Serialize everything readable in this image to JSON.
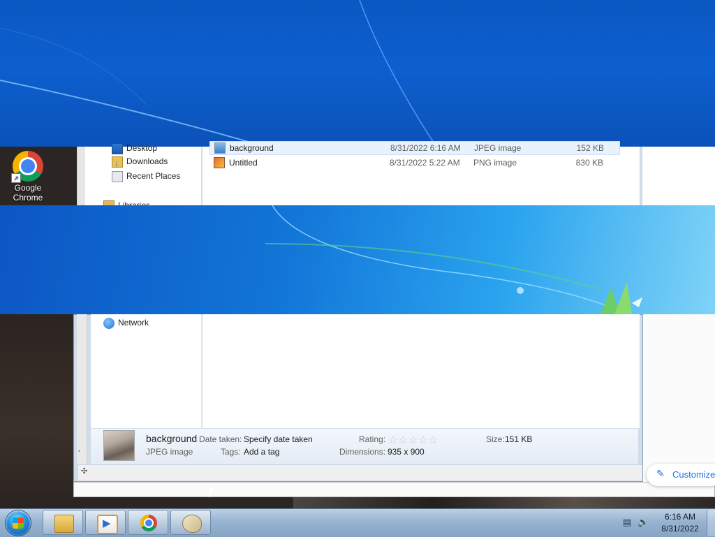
{
  "desktop": {
    "icons": [
      {
        "label": "Google Chrome",
        "icon": "chrome-icon"
      }
    ]
  },
  "explorer": {
    "nav": {
      "items": [
        {
          "label": "Desktop",
          "icon": "desktop-icon"
        },
        {
          "label": "Downloads",
          "icon": "downloads-icon"
        },
        {
          "label": "Recent Places",
          "icon": "recent-places-icon"
        },
        {
          "label": "Libraries",
          "icon": "libraries-icon"
        },
        {
          "label": "Network",
          "icon": "network-icon"
        }
      ]
    },
    "files": [
      {
        "name": "background",
        "date": "8/31/2022 6:16 AM",
        "type": "JPEG image",
        "size": "152 KB",
        "selected": true,
        "icon": "jpeg-file-icon"
      },
      {
        "name": "Untitled",
        "date": "8/31/2022 5:22 AM",
        "type": "PNG image",
        "size": "830 KB",
        "selected": false,
        "icon": "png-file-icon"
      }
    ],
    "details": {
      "name": "background",
      "type": "JPEG image",
      "date_taken_label": "Date taken:",
      "date_taken_value": "Specify date taken",
      "tags_label": "Tags:",
      "tags_value": "Add a tag",
      "rating_label": "Rating:",
      "rating_stars": 0,
      "rating_max": 5,
      "dimensions_label": "Dimensions:",
      "dimensions_value": "935 x 900",
      "size_label": "Size:",
      "size_value": "151 KB"
    }
  },
  "customize": {
    "label": "Customize",
    "icon": "pencil-icon"
  },
  "taskbar": {
    "start": {
      "icon": "windows-start-icon"
    },
    "buttons": [
      {
        "name": "Windows Explorer",
        "icon": "folder-icon"
      },
      {
        "name": "Windows Media Player",
        "icon": "media-player-icon"
      },
      {
        "name": "Google Chrome",
        "icon": "chrome-icon"
      },
      {
        "name": "Paint",
        "icon": "paint-icon"
      }
    ],
    "tray": {
      "network_icon": "network-tray-icon",
      "volume_icon": "volume-icon"
    },
    "clock": {
      "time": "6:16 AM",
      "date": "8/31/2022"
    }
  },
  "colors": {
    "wallpaper_blue": "#0b55c0",
    "taskbar": "#98b3d0",
    "link_blue": "#1a73e8",
    "selection": "#e8f1fc"
  }
}
